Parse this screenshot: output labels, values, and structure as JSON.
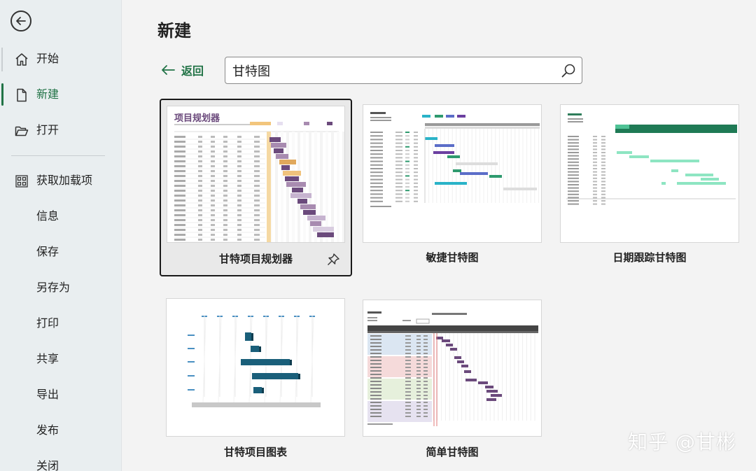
{
  "sidebar": {
    "items": [
      {
        "label": "开始"
      },
      {
        "label": "新建"
      },
      {
        "label": "打开"
      },
      {
        "label": "获取加载项"
      },
      {
        "label": "信息"
      },
      {
        "label": "保存"
      },
      {
        "label": "另存为"
      },
      {
        "label": "打印"
      },
      {
        "label": "共享"
      },
      {
        "label": "导出"
      },
      {
        "label": "发布"
      },
      {
        "label": "关闭"
      }
    ]
  },
  "main": {
    "title": "新建",
    "back_label": "返回",
    "search": {
      "value": "甘特图"
    },
    "templates": [
      {
        "name": "甘特项目规划器",
        "thumb_title": "项目规划器"
      },
      {
        "name": "敏捷甘特图"
      },
      {
        "name": "日期跟踪甘特图"
      },
      {
        "name": "甘特项目图表"
      },
      {
        "name": "简单甘特图"
      }
    ]
  },
  "watermark": "知乎 @甘彬",
  "colors": {
    "accent": "#217346",
    "purple": "#6b4a7c",
    "teal": "#1a5f7a"
  }
}
